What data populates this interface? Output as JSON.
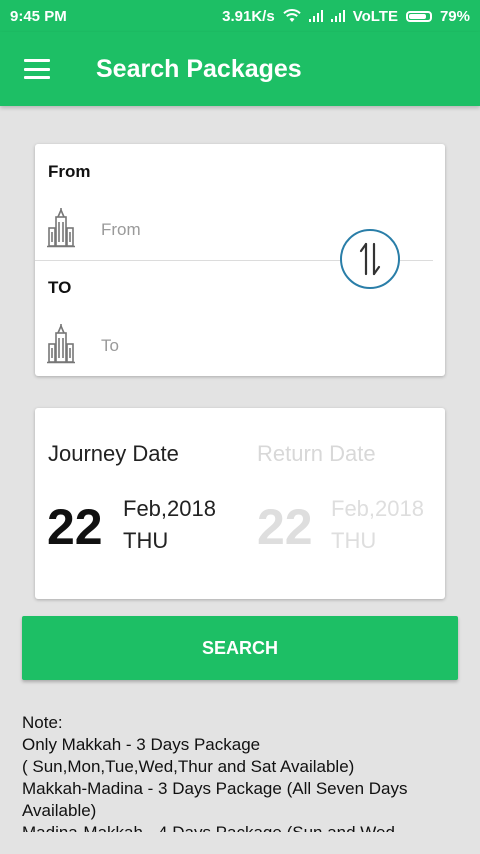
{
  "status_bar": {
    "time": "9:45 PM",
    "network_speed": "3.91K/s",
    "carrier": "VoLTE",
    "battery": "79%",
    "icons": [
      "wifi-icon",
      "signal-icon",
      "signal-icon",
      "battery-icon"
    ]
  },
  "app_bar": {
    "title": "Search Packages",
    "menu_icon": "hamburger-menu-icon"
  },
  "route": {
    "from_label": "From",
    "from_placeholder": "From",
    "from_value": "",
    "to_label": "TO",
    "to_placeholder": "To",
    "to_value": "",
    "location_icon": "city-building-icon",
    "swap_icon": "swap-arrows-icon"
  },
  "dates": {
    "journey": {
      "label": "Journey Date",
      "day": "22",
      "month_year": "Feb,2018",
      "weekday": "THU"
    },
    "return": {
      "label": "Return Date",
      "day": "22",
      "month_year": "Feb,2018",
      "weekday": "THU"
    }
  },
  "search_button": {
    "label": "SEARCH"
  },
  "note": {
    "title": "Note:",
    "lines": [
      "Only Makkah - 3 Days Package",
      "( Sun,Mon,Tue,Wed,Thur and Sat Available)",
      "Makkah-Madina - 3 Days Package (All Seven Days Available)",
      "Madina-Makkah - 4 Days Package (Sun and Wed"
    ]
  },
  "colors": {
    "primary": "#1dbf65",
    "swap_ring": "#2a7ea8",
    "background": "#e3e3e3",
    "inactive_text": "#d8d8d8"
  }
}
